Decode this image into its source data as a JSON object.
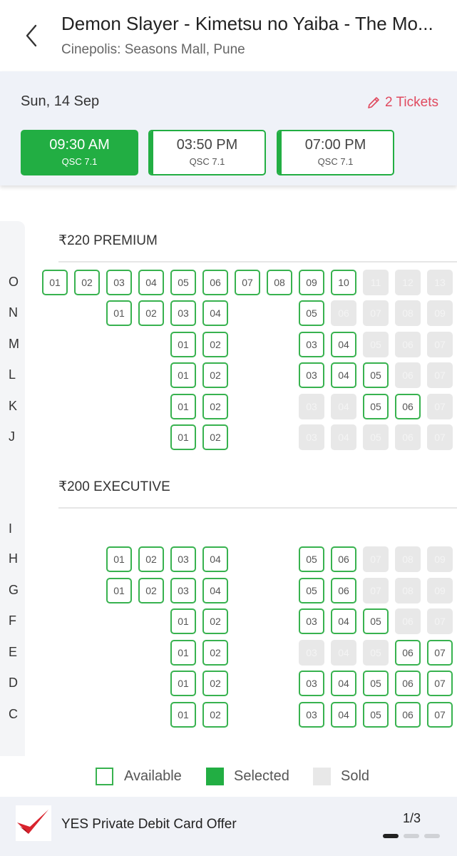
{
  "header": {
    "title": "Demon Slayer - Kimetsu no Yaiba - The Mo...",
    "subtitle": "Cinepolis: Seasons Mall, Pune"
  },
  "booking": {
    "date": "Sun, 14 Sep",
    "tickets_label": "2 Tickets",
    "showtimes": [
      {
        "time": "09:30 AM",
        "format": "QSC 7.1",
        "selected": true
      },
      {
        "time": "03:50 PM",
        "format": "QSC 7.1",
        "selected": false
      },
      {
        "time": "07:00 PM",
        "format": "QSC 7.1",
        "selected": false
      }
    ]
  },
  "seatmap": {
    "sections": [
      {
        "label": "₹220 PREMIUM"
      },
      {
        "label": "₹200 EXECUTIVE"
      }
    ],
    "rows": [
      {
        "label": "O",
        "section": 0,
        "seats": [
          {
            "col": 0,
            "num": "01",
            "status": "available"
          },
          {
            "col": 1,
            "num": "02",
            "status": "available"
          },
          {
            "col": 2,
            "num": "03",
            "status": "available"
          },
          {
            "col": 3,
            "num": "04",
            "status": "available"
          },
          {
            "col": 4,
            "num": "05",
            "status": "available"
          },
          {
            "col": 5,
            "num": "06",
            "status": "available"
          },
          {
            "col": 6,
            "num": "07",
            "status": "available"
          },
          {
            "col": 7,
            "num": "08",
            "status": "available"
          },
          {
            "col": 8,
            "num": "09",
            "status": "available"
          },
          {
            "col": 9,
            "num": "10",
            "status": "available"
          },
          {
            "col": 10,
            "num": "11",
            "status": "sold"
          },
          {
            "col": 11,
            "num": "12",
            "status": "sold"
          },
          {
            "col": 12,
            "num": "13",
            "status": "sold"
          }
        ]
      },
      {
        "label": "N",
        "section": 0,
        "seats": [
          {
            "col": 2,
            "num": "01",
            "status": "available"
          },
          {
            "col": 3,
            "num": "02",
            "status": "available"
          },
          {
            "col": 4,
            "num": "03",
            "status": "available"
          },
          {
            "col": 5,
            "num": "04",
            "status": "available"
          },
          {
            "col": 8,
            "num": "05",
            "status": "available"
          },
          {
            "col": 9,
            "num": "06",
            "status": "sold"
          },
          {
            "col": 10,
            "num": "07",
            "status": "sold"
          },
          {
            "col": 11,
            "num": "08",
            "status": "sold"
          },
          {
            "col": 12,
            "num": "09",
            "status": "sold"
          }
        ]
      },
      {
        "label": "M",
        "section": 0,
        "seats": [
          {
            "col": 4,
            "num": "01",
            "status": "available"
          },
          {
            "col": 5,
            "num": "02",
            "status": "available"
          },
          {
            "col": 8,
            "num": "03",
            "status": "available"
          },
          {
            "col": 9,
            "num": "04",
            "status": "available"
          },
          {
            "col": 10,
            "num": "05",
            "status": "sold"
          },
          {
            "col": 11,
            "num": "06",
            "status": "sold"
          },
          {
            "col": 12,
            "num": "07",
            "status": "sold"
          }
        ]
      },
      {
        "label": "L",
        "section": 0,
        "seats": [
          {
            "col": 4,
            "num": "01",
            "status": "available"
          },
          {
            "col": 5,
            "num": "02",
            "status": "available"
          },
          {
            "col": 8,
            "num": "03",
            "status": "available"
          },
          {
            "col": 9,
            "num": "04",
            "status": "available"
          },
          {
            "col": 10,
            "num": "05",
            "status": "available"
          },
          {
            "col": 11,
            "num": "06",
            "status": "sold"
          },
          {
            "col": 12,
            "num": "07",
            "status": "sold"
          }
        ]
      },
      {
        "label": "K",
        "section": 0,
        "seats": [
          {
            "col": 4,
            "num": "01",
            "status": "available"
          },
          {
            "col": 5,
            "num": "02",
            "status": "available"
          },
          {
            "col": 8,
            "num": "03",
            "status": "sold"
          },
          {
            "col": 9,
            "num": "04",
            "status": "sold"
          },
          {
            "col": 10,
            "num": "05",
            "status": "available"
          },
          {
            "col": 11,
            "num": "06",
            "status": "available"
          },
          {
            "col": 12,
            "num": "07",
            "status": "sold"
          }
        ]
      },
      {
        "label": "J",
        "section": 0,
        "seats": [
          {
            "col": 4,
            "num": "01",
            "status": "available"
          },
          {
            "col": 5,
            "num": "02",
            "status": "available"
          },
          {
            "col": 8,
            "num": "03",
            "status": "sold"
          },
          {
            "col": 9,
            "num": "04",
            "status": "sold"
          },
          {
            "col": 10,
            "num": "05",
            "status": "sold"
          },
          {
            "col": 11,
            "num": "06",
            "status": "sold"
          },
          {
            "col": 12,
            "num": "07",
            "status": "sold"
          }
        ]
      },
      {
        "label": "I",
        "section": 1,
        "seats": []
      },
      {
        "label": "H",
        "section": 1,
        "seats": [
          {
            "col": 2,
            "num": "01",
            "status": "available"
          },
          {
            "col": 3,
            "num": "02",
            "status": "available"
          },
          {
            "col": 4,
            "num": "03",
            "status": "available"
          },
          {
            "col": 5,
            "num": "04",
            "status": "available"
          },
          {
            "col": 8,
            "num": "05",
            "status": "available"
          },
          {
            "col": 9,
            "num": "06",
            "status": "available"
          },
          {
            "col": 10,
            "num": "07",
            "status": "sold"
          },
          {
            "col": 11,
            "num": "08",
            "status": "sold"
          },
          {
            "col": 12,
            "num": "09",
            "status": "sold"
          }
        ]
      },
      {
        "label": "G",
        "section": 1,
        "seats": [
          {
            "col": 2,
            "num": "01",
            "status": "available"
          },
          {
            "col": 3,
            "num": "02",
            "status": "available"
          },
          {
            "col": 4,
            "num": "03",
            "status": "available"
          },
          {
            "col": 5,
            "num": "04",
            "status": "available"
          },
          {
            "col": 8,
            "num": "05",
            "status": "available"
          },
          {
            "col": 9,
            "num": "06",
            "status": "available"
          },
          {
            "col": 10,
            "num": "07",
            "status": "sold"
          },
          {
            "col": 11,
            "num": "08",
            "status": "sold"
          },
          {
            "col": 12,
            "num": "09",
            "status": "sold"
          }
        ]
      },
      {
        "label": "F",
        "section": 1,
        "seats": [
          {
            "col": 4,
            "num": "01",
            "status": "available"
          },
          {
            "col": 5,
            "num": "02",
            "status": "available"
          },
          {
            "col": 8,
            "num": "03",
            "status": "available"
          },
          {
            "col": 9,
            "num": "04",
            "status": "available"
          },
          {
            "col": 10,
            "num": "05",
            "status": "available"
          },
          {
            "col": 11,
            "num": "06",
            "status": "sold"
          },
          {
            "col": 12,
            "num": "07",
            "status": "sold"
          }
        ]
      },
      {
        "label": "E",
        "section": 1,
        "seats": [
          {
            "col": 4,
            "num": "01",
            "status": "available"
          },
          {
            "col": 5,
            "num": "02",
            "status": "available"
          },
          {
            "col": 8,
            "num": "03",
            "status": "sold"
          },
          {
            "col": 9,
            "num": "04",
            "status": "sold"
          },
          {
            "col": 10,
            "num": "05",
            "status": "sold"
          },
          {
            "col": 11,
            "num": "06",
            "status": "available"
          },
          {
            "col": 12,
            "num": "07",
            "status": "available"
          }
        ]
      },
      {
        "label": "D",
        "section": 1,
        "seats": [
          {
            "col": 4,
            "num": "01",
            "status": "available"
          },
          {
            "col": 5,
            "num": "02",
            "status": "available"
          },
          {
            "col": 8,
            "num": "03",
            "status": "available"
          },
          {
            "col": 9,
            "num": "04",
            "status": "available"
          },
          {
            "col": 10,
            "num": "05",
            "status": "available"
          },
          {
            "col": 11,
            "num": "06",
            "status": "available"
          },
          {
            "col": 12,
            "num": "07",
            "status": "available"
          }
        ]
      },
      {
        "label": "C",
        "section": 1,
        "seats": [
          {
            "col": 4,
            "num": "01",
            "status": "available"
          },
          {
            "col": 5,
            "num": "02",
            "status": "available"
          },
          {
            "col": 8,
            "num": "03",
            "status": "available"
          },
          {
            "col": 9,
            "num": "04",
            "status": "available"
          },
          {
            "col": 10,
            "num": "05",
            "status": "available"
          },
          {
            "col": 11,
            "num": "06",
            "status": "available"
          },
          {
            "col": 12,
            "num": "07",
            "status": "available"
          }
        ]
      }
    ]
  },
  "legend": {
    "available": "Available",
    "selected": "Selected",
    "sold": "Sold"
  },
  "offer": {
    "text": "YES Private Debit Card Offer",
    "counter": "1/3",
    "active_index": 0,
    "total": 3
  },
  "colors": {
    "accent_green": "#22ae43",
    "tickets_red": "#e04a5f",
    "sold_gray": "#e8e8e8"
  }
}
